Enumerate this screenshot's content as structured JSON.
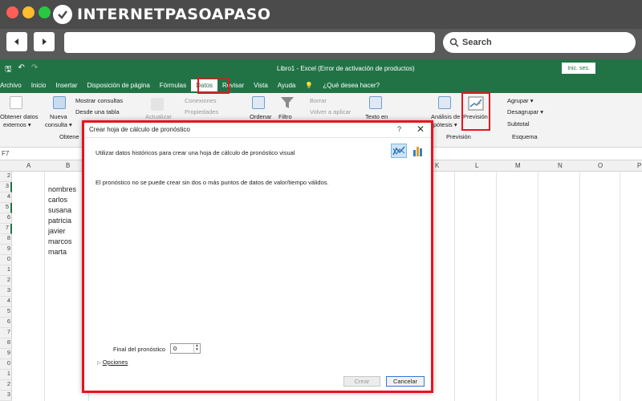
{
  "browser": {
    "logo_text": "INTERNETPASOAPASO",
    "search_label": "Search",
    "traffic_colors": [
      "#ff5f57",
      "#febc2e",
      "#28c840"
    ]
  },
  "excel": {
    "window_title": "Libro1 - Excel (Error de activación de productos)",
    "signin": "Inic. ses.",
    "menu": [
      "Archivo",
      "Inicio",
      "Insertar",
      "Disposición de página",
      "Fórmulas",
      "Datos",
      "Revisar",
      "Vista",
      "Ayuda",
      "¿Qué desea hacer?"
    ],
    "active_tab": "Datos",
    "ribbon": {
      "obtener_datos": "Obtener datos",
      "externos": "externos ▾",
      "nueva": "Nueva",
      "consulta": "consulta ▾",
      "mostrar_consultas": "Mostrar consultas",
      "desde_tabla": "Desde una tabla",
      "obten": "Obtene",
      "actualizar": "Actualizar",
      "conexiones": "Conexiones",
      "propiedades": "Propiedades",
      "ordenar": "Ordenar",
      "filtro": "Filtro",
      "borrar": "Borrar",
      "volver_aplicar": "Volver a aplicar",
      "texto_en": "Texto en",
      "analisis": "Análisis de",
      "hipotesis": "pótesis ▾",
      "prevision": "Previsión",
      "prevision_group": "Previsión",
      "agrupar": "Agrupar ▾",
      "desagrupar": "Desagrupar ▾",
      "subtotal": "Subtotal",
      "esquema": "Esquema"
    },
    "name_box": "F7",
    "columns": [
      "A",
      "B",
      "K",
      "L",
      "M",
      "N",
      "O",
      "P"
    ],
    "cells": [
      "nombres",
      "carlos",
      "susana",
      "patricia",
      "javier",
      "marcos",
      "marta"
    ],
    "row_numbers": [
      "2",
      "3",
      "4",
      "5",
      "6",
      "7",
      "8",
      "9",
      "0",
      "1",
      "2",
      "3",
      "4",
      "5",
      "6",
      "7",
      "8",
      "9",
      "0",
      "1",
      "2",
      "3"
    ]
  },
  "dialog": {
    "title": "Crear hoja de cálculo de pronóstico",
    "help": "?",
    "close": "✕",
    "instruction": "Utilizar datos históricos para crear una hoja de cálculo de pronóstico visual",
    "message": "El pronóstico no se puede crear sin dos o más puntos de datos de valor/tiempo válidos.",
    "final_label": "Final del pronóstico",
    "final_value": "0",
    "options": "Opciones",
    "create": "Crear",
    "cancel": "Cancelar"
  }
}
